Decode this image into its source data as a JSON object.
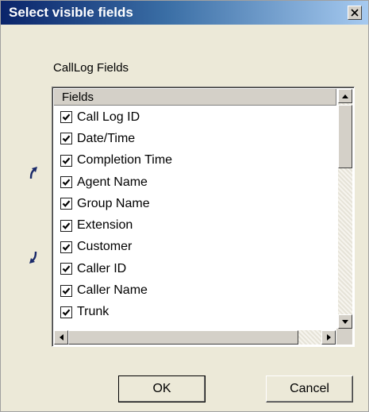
{
  "dialog": {
    "title": "Select visible fields"
  },
  "group": {
    "label": "CallLog Fields"
  },
  "list": {
    "header": "Fields",
    "items": [
      {
        "label": "Call Log ID",
        "checked": true
      },
      {
        "label": "Date/Time",
        "checked": true
      },
      {
        "label": "Completion Time",
        "checked": true
      },
      {
        "label": "Agent Name",
        "checked": true
      },
      {
        "label": "Group Name",
        "checked": true
      },
      {
        "label": "Extension",
        "checked": true
      },
      {
        "label": "Customer",
        "checked": true
      },
      {
        "label": "Caller ID",
        "checked": true
      },
      {
        "label": "Caller Name",
        "checked": true
      },
      {
        "label": "Trunk",
        "checked": true
      }
    ]
  },
  "buttons": {
    "ok": "OK",
    "cancel": "Cancel"
  },
  "icons": {
    "close": "close-icon",
    "move_up": "arrow-up-icon",
    "move_down": "arrow-down-icon",
    "check": "checkmark-icon"
  },
  "colors": {
    "titlebar_start": "#0a246a",
    "titlebar_end": "#a6caf0",
    "dialog_bg": "#ece9d8"
  }
}
